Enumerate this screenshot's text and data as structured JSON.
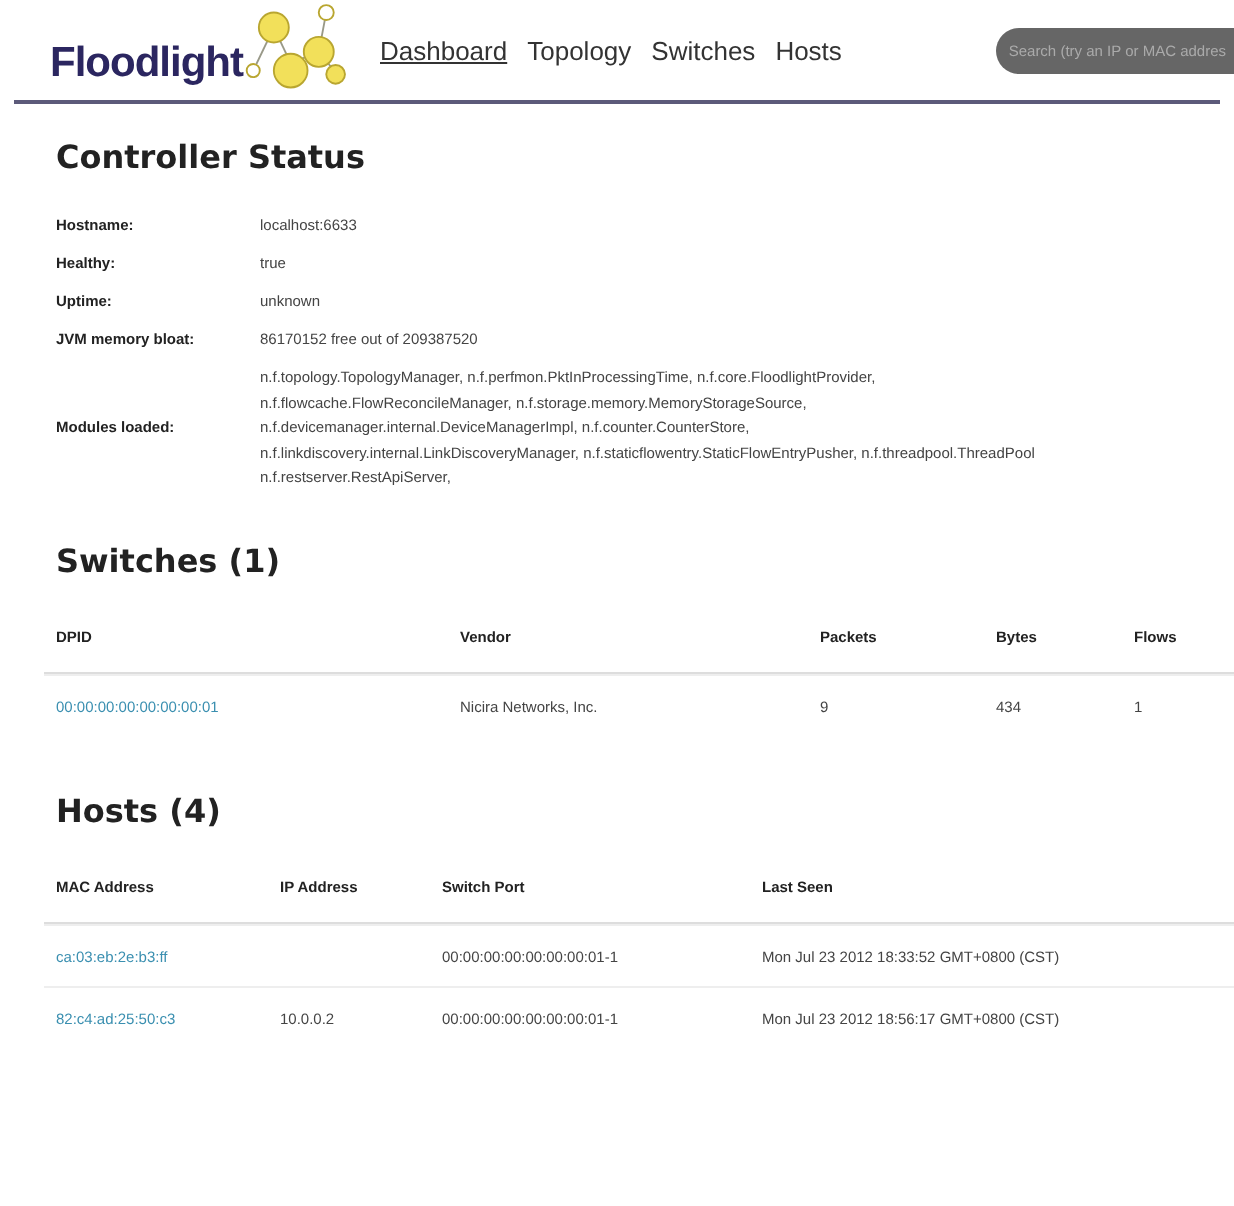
{
  "header": {
    "logo": "Floodlight",
    "nav": [
      {
        "label": "Dashboard",
        "selected": true
      },
      {
        "label": "Topology",
        "selected": false
      },
      {
        "label": "Switches",
        "selected": false
      },
      {
        "label": "Hosts",
        "selected": false
      }
    ],
    "search": {
      "placeholder": "Search (try an IP or MAC addres"
    }
  },
  "controller_status": {
    "title": "Controller Status",
    "rows": [
      {
        "label": "Hostname:",
        "value": [
          "localhost:6633"
        ]
      },
      {
        "label": "Healthy:",
        "value": [
          "true"
        ]
      },
      {
        "label": "Uptime:",
        "value": [
          "unknown"
        ]
      },
      {
        "label": "JVM memory bloat:",
        "value": [
          "86170152 free out of 209387520"
        ]
      },
      {
        "label": "Modules loaded:",
        "value": [
          "n.f.topology.TopologyManager, n.f.perfmon.PktInProcessingTime, n.f.core.FloodlightProvider,",
          "n.f.flowcache.FlowReconcileManager, n.f.storage.memory.MemoryStorageSource,",
          "n.f.devicemanager.internal.DeviceManagerImpl, n.f.counter.CounterStore,",
          "n.f.linkdiscovery.internal.LinkDiscoveryManager, n.f.staticflowentry.StaticFlowEntryPusher, n.f.threadpool.ThreadPool",
          "n.f.restserver.RestApiServer,"
        ]
      }
    ]
  },
  "switches": {
    "title": "Switches (1)",
    "columns": [
      "DPID",
      "Vendor",
      "Packets",
      "Bytes",
      "Flows"
    ],
    "rows": [
      {
        "cells": [
          "00:00:00:00:00:00:00:01",
          "Nicira Networks, Inc.",
          "9",
          "434",
          "1"
        ]
      }
    ]
  },
  "hosts": {
    "title": "Hosts (4)",
    "columns": [
      "MAC Address",
      "IP Address",
      "Switch Port",
      "Last Seen"
    ],
    "rows": [
      {
        "cells": [
          "ca:03:eb:2e:b3:ff",
          "",
          "00:00:00:00:00:00:00:01-1",
          "Mon Jul 23 2012 18:33:52 GMT+0800 (CST)"
        ]
      },
      {
        "cells": [
          "82:c4:ad:25:50:c3",
          "10.0.0.2",
          "00:00:00:00:00:00:00:01-1",
          "Mon Jul 23 2012 18:56:17 GMT+0800 (CST)"
        ]
      }
    ]
  }
}
